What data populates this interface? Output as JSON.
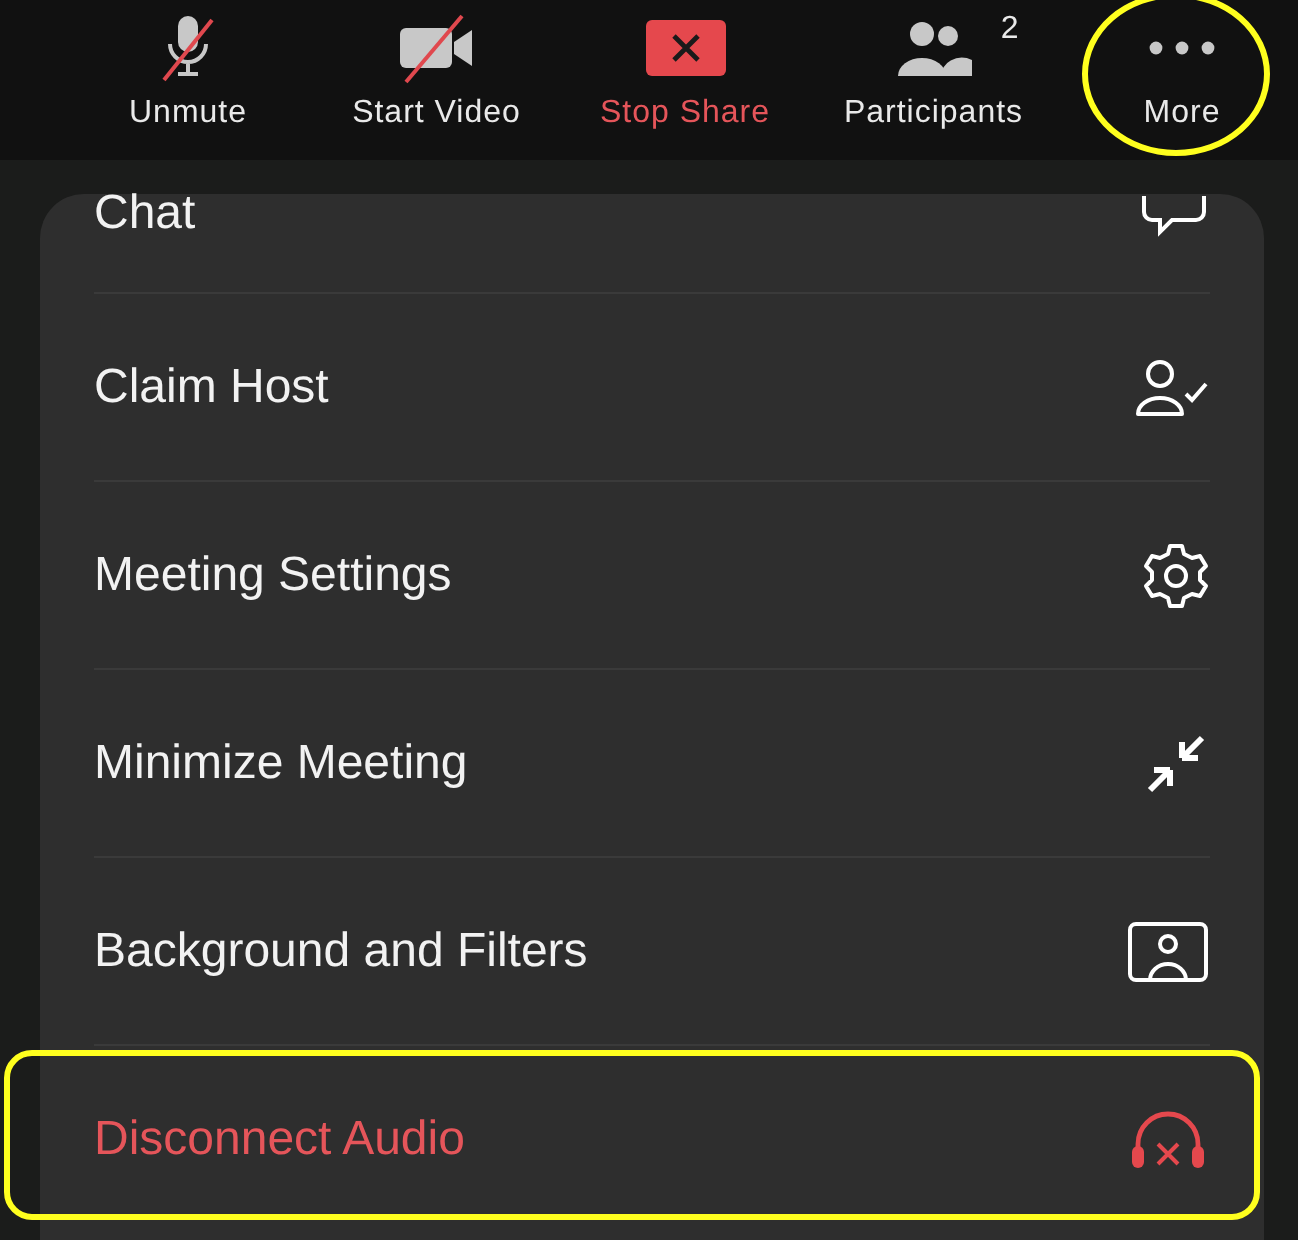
{
  "toolbar": [
    {
      "kind": "mic",
      "label": "Unmute",
      "danger": false,
      "highlighted": false
    },
    {
      "kind": "video",
      "label": "Start Video",
      "danger": false,
      "highlighted": false
    },
    {
      "kind": "share",
      "label": "Stop Share",
      "danger": true,
      "highlighted": false
    },
    {
      "kind": "participants",
      "label": "Participants",
      "count": "2",
      "danger": false,
      "highlighted": false
    },
    {
      "kind": "more",
      "label": "More",
      "danger": false,
      "highlighted": true
    }
  ],
  "menu": [
    {
      "kind": "chat",
      "label": "Chat",
      "danger": false,
      "highlighted": false
    },
    {
      "kind": "claim",
      "label": "Claim Host",
      "danger": false,
      "highlighted": false
    },
    {
      "kind": "settings",
      "label": "Meeting Settings",
      "danger": false,
      "highlighted": false
    },
    {
      "kind": "minimize",
      "label": "Minimize Meeting",
      "danger": false,
      "highlighted": false
    },
    {
      "kind": "background",
      "label": "Background and Filters",
      "danger": false,
      "highlighted": false
    },
    {
      "kind": "audio",
      "label": "Disconnect Audio",
      "danger": true,
      "highlighted": true
    }
  ]
}
